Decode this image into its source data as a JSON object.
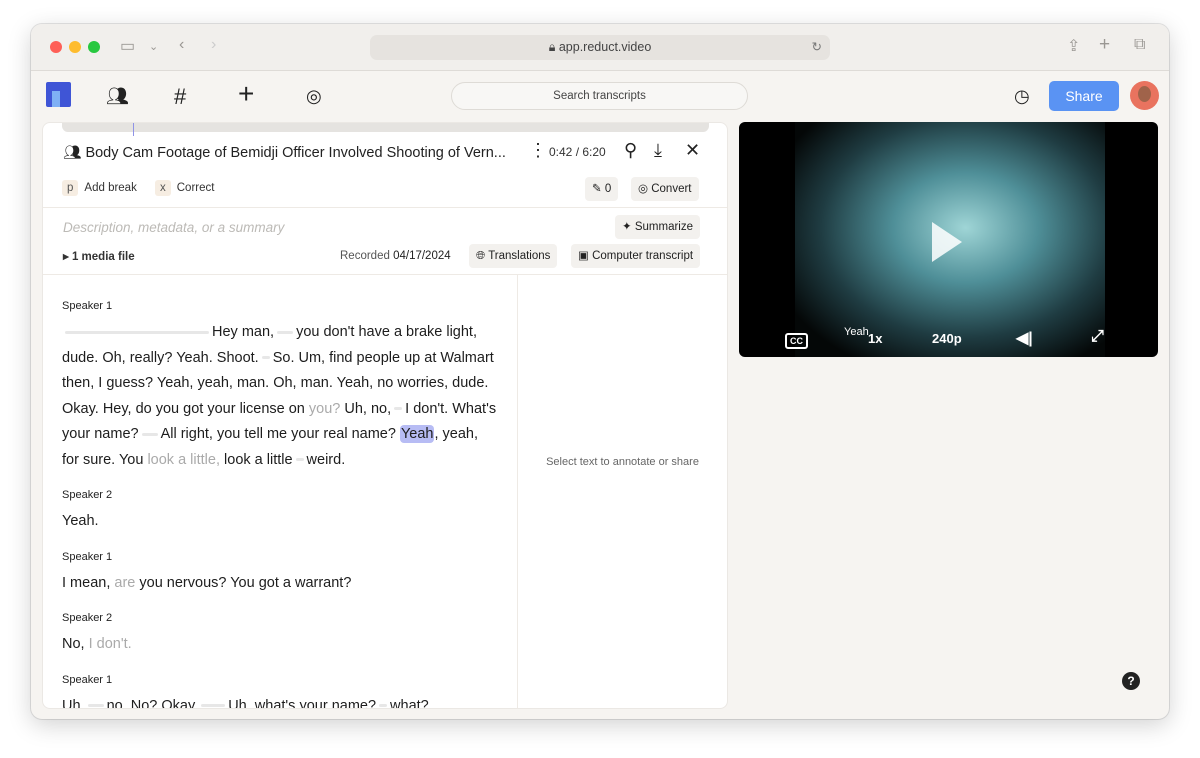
{
  "browser": {
    "url": "app.reduct.video"
  },
  "appbar": {
    "search_placeholder": "Search transcripts",
    "share_label": "Share",
    "brand_color": "#5a93f3"
  },
  "doc": {
    "title": "Body Cam Footage of Bemidji Officer Involved Shooting of Vern...",
    "time": "0:42 / 6:20",
    "shortcuts": [
      {
        "key": "p",
        "label": "Add break"
      },
      {
        "key": "x",
        "label": "Correct"
      }
    ],
    "highlight_count": "0",
    "convert_label": "Convert",
    "description_placeholder": "Description, metadata, or a summary",
    "summarize_label": "Summarize",
    "media_files": "1 media file",
    "recorded_label": "Recorded",
    "recorded_date": "04/17/2024",
    "translations_label": "Translations",
    "transcript_type_label": "Computer transcript",
    "annotate_hint": "Select text to annotate or share",
    "progress_fraction": 0.11
  },
  "transcript": [
    {
      "speaker": "Speaker 1",
      "tokens": [
        {
          "t": "gap",
          "n": 18
        },
        {
          "t": "txt",
          "v": "Hey man,"
        },
        {
          "t": "gap",
          "n": 2
        },
        {
          "t": "txt",
          "v": "you don't have a brake light, dude. Oh, really? Yeah. Shoot."
        },
        {
          "t": "gap",
          "n": 1
        },
        {
          "t": "txt",
          "v": "So. Um, find people up at Walmart then, I guess? Yeah, yeah, man. Oh, man. Yeah, no worries, dude. Okay. Hey, do you got your license on "
        },
        {
          "t": "dim",
          "v": "you?"
        },
        {
          "t": "txt",
          "v": " Uh, no,"
        },
        {
          "t": "gap",
          "n": 1
        },
        {
          "t": "txt",
          "v": "I don't. What's your name?"
        },
        {
          "t": "gap",
          "n": 2
        },
        {
          "t": "txt",
          "v": "All right, you tell me your real name? "
        },
        {
          "t": "hl",
          "v": "Yeah"
        },
        {
          "t": "txt",
          "v": ", yeah, for sure. You "
        },
        {
          "t": "dim",
          "v": "look a little,"
        },
        {
          "t": "txt",
          "v": " look a little"
        },
        {
          "t": "gap",
          "n": 1
        },
        {
          "t": "txt",
          "v": "weird."
        }
      ]
    },
    {
      "speaker": "Speaker 2",
      "tokens": [
        {
          "t": "txt",
          "v": "Yeah."
        }
      ]
    },
    {
      "speaker": "Speaker 1",
      "tokens": [
        {
          "t": "txt",
          "v": "I mean, "
        },
        {
          "t": "dim",
          "v": "are"
        },
        {
          "t": "txt",
          "v": " you nervous? You got a warrant?"
        }
      ]
    },
    {
      "speaker": "Speaker 2",
      "tokens": [
        {
          "t": "txt",
          "v": "No, "
        },
        {
          "t": "dim",
          "v": "I don't."
        }
      ]
    },
    {
      "speaker": "Speaker 1",
      "tokens": [
        {
          "t": "txt",
          "v": "Uh,"
        },
        {
          "t": "gap",
          "n": 2
        },
        {
          "t": "txt",
          "v": "no. No? Okay."
        },
        {
          "t": "gap",
          "n": 3
        },
        {
          "t": "txt",
          "v": "Uh, what's your name?"
        },
        {
          "t": "gap",
          "n": 1
        },
        {
          "t": "txt",
          "v": "what?"
        }
      ]
    }
  ],
  "video": {
    "caption": "Yeah",
    "speed": "1x",
    "quality": "240p",
    "cc_label": "CC"
  }
}
